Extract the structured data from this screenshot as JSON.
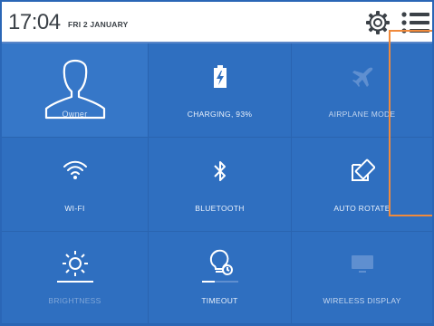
{
  "status_bar": {
    "time": "17:04",
    "date": "FRI 2 JANUARY"
  },
  "tiles": [
    {
      "label": "Owner",
      "icon": "user-icon",
      "active": true
    },
    {
      "label": "CHARGING, 93%",
      "icon": "battery-charging-icon",
      "active": true
    },
    {
      "label": "AIRPLANE MODE",
      "icon": "airplane-icon",
      "active": false
    },
    {
      "label": "WI-FI",
      "icon": "wifi-icon",
      "active": true
    },
    {
      "label": "BLUETOOTH",
      "icon": "bluetooth-icon",
      "active": true
    },
    {
      "label": "AUTO ROTATE",
      "icon": "auto-rotate-icon",
      "active": true
    },
    {
      "label": "BRIGHTNESS",
      "icon": "brightness-icon",
      "active": false
    },
    {
      "label": "TIMEOUT",
      "icon": "timeout-icon",
      "active": true
    },
    {
      "label": "WIRELESS DISPLAY",
      "icon": "wireless-display-icon",
      "active": false
    }
  ],
  "colors": {
    "panel": "#2f6fc0",
    "accent_callout": "#f08a3c",
    "icon": "#ffffff",
    "icon_dim": "#5f8fd0"
  }
}
